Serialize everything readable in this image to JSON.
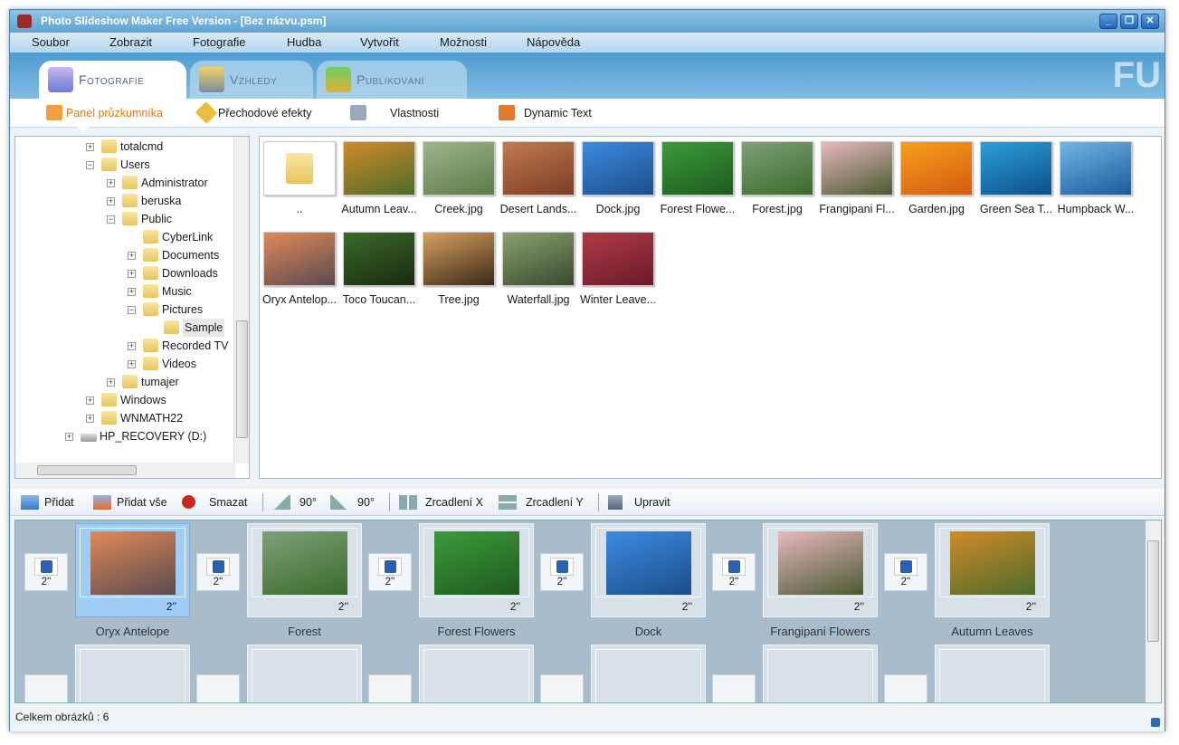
{
  "window": {
    "title": "Photo Slideshow Maker Free Version - [Bez názvu.psm]",
    "minimize": "_",
    "restore": "❐",
    "close": "✕"
  },
  "menu": [
    "Soubor",
    "Zobrazit",
    "Fotografie",
    "Hudba",
    "Vytvořit",
    "Možnosti",
    "Nápověda"
  ],
  "tabs": [
    {
      "label": "Fotografie"
    },
    {
      "label": "Vzhledy"
    },
    {
      "label": "Publikování"
    }
  ],
  "logo_text": "FU",
  "subtabs": [
    "Panel průzkumníka",
    "Přechodové efekty",
    "Vlastnosti",
    "Dynamic Text"
  ],
  "tree": [
    {
      "label": "totalcmd",
      "level": 0,
      "exp": "+"
    },
    {
      "label": "Users",
      "level": 0,
      "exp": "-"
    },
    {
      "label": "Administrator",
      "level": 1,
      "exp": "+"
    },
    {
      "label": "beruska",
      "level": 1,
      "exp": "+"
    },
    {
      "label": "Public",
      "level": 1,
      "exp": "-"
    },
    {
      "label": "CyberLink",
      "level": 2,
      "exp": ""
    },
    {
      "label": "Documents",
      "level": 2,
      "exp": "+"
    },
    {
      "label": "Downloads",
      "level": 2,
      "exp": "+"
    },
    {
      "label": "Music",
      "level": 2,
      "exp": "+"
    },
    {
      "label": "Pictures",
      "level": 2,
      "exp": "-"
    },
    {
      "label": "Sample",
      "level": 3,
      "exp": "",
      "selected": true
    },
    {
      "label": "Recorded TV",
      "level": 2,
      "exp": "+"
    },
    {
      "label": "Videos",
      "level": 2,
      "exp": "+"
    },
    {
      "label": "tumajer",
      "level": 1,
      "exp": "+"
    },
    {
      "label": "Windows",
      "level": 0,
      "exp": "+"
    },
    {
      "label": "WNMATH22",
      "level": 0,
      "exp": "+"
    },
    {
      "label": "HP_RECOVERY (D:)",
      "level": -1,
      "exp": "+",
      "drive": true
    }
  ],
  "files": [
    {
      "label": "..",
      "colors": [
        "#fbe9a8",
        "#e8c45a"
      ]
    },
    {
      "label": "Autumn Leav...",
      "colors": [
        "#d18a2a",
        "#4d6b2a"
      ]
    },
    {
      "label": "Creek.jpg",
      "colors": [
        "#9fb58a",
        "#5c7a48"
      ]
    },
    {
      "label": "Desert Lands...",
      "colors": [
        "#c27a4e",
        "#7a3d26"
      ]
    },
    {
      "label": "Dock.jpg",
      "colors": [
        "#3c8be0",
        "#1c4d8a"
      ]
    },
    {
      "label": "Forest Flowe...",
      "colors": [
        "#3c9a3a",
        "#1d5a1f"
      ]
    },
    {
      "label": "Forest.jpg",
      "colors": [
        "#7fa07a",
        "#3a6a2a"
      ]
    },
    {
      "label": "Frangipani Fl...",
      "colors": [
        "#e8b9c0",
        "#4a5a30"
      ]
    },
    {
      "label": "Garden.jpg",
      "colors": [
        "#f7a01c",
        "#d45a10"
      ]
    },
    {
      "label": "Green Sea T...",
      "colors": [
        "#2ca0d8",
        "#0d4e8a"
      ]
    },
    {
      "label": "Humpback W...",
      "colors": [
        "#6fb7e6",
        "#1a5a9a"
      ]
    },
    {
      "label": "Oryx Antelop...",
      "colors": [
        "#e08a58",
        "#5a4a50"
      ]
    },
    {
      "label": "Toco Toucan...",
      "colors": [
        "#3a6a2a",
        "#1a2a10"
      ]
    },
    {
      "label": "Tree.jpg",
      "colors": [
        "#d8a060",
        "#3a2a18"
      ]
    },
    {
      "label": "Waterfall.jpg",
      "colors": [
        "#8aa070",
        "#3a4a30"
      ]
    },
    {
      "label": "Winter Leave...",
      "colors": [
        "#b03a48",
        "#6a1a2a"
      ]
    }
  ],
  "toolbar": {
    "add": "Přidat",
    "add_all": "Přidat vše",
    "delete": "Smazat",
    "rot_left": "90°",
    "rot_right": "90°",
    "mirror_x": "Zrcadlení X",
    "mirror_y": "Zrcadlení Y",
    "edit": "Upravit"
  },
  "storyboard": {
    "transition_duration": "2''",
    "slides": [
      {
        "title": "Oryx Antelope",
        "duration": "2''",
        "selected": true,
        "colors": [
          "#e08a58",
          "#5a4a50"
        ]
      },
      {
        "title": "Forest",
        "duration": "2''",
        "colors": [
          "#7fa07a",
          "#3a6a2a"
        ]
      },
      {
        "title": "Forest Flowers",
        "duration": "2''",
        "colors": [
          "#3c9a3a",
          "#1d5a1f"
        ]
      },
      {
        "title": "Dock",
        "duration": "2''",
        "colors": [
          "#3c8be0",
          "#1c4d8a"
        ]
      },
      {
        "title": "Frangipani Flowers",
        "duration": "2''",
        "colors": [
          "#e8b9c0",
          "#4a5a30"
        ]
      },
      {
        "title": "Autumn Leaves",
        "duration": "2''",
        "colors": [
          "#d18a2a",
          "#4d6b2a"
        ]
      }
    ]
  },
  "status": "Celkem obrázků : 6"
}
